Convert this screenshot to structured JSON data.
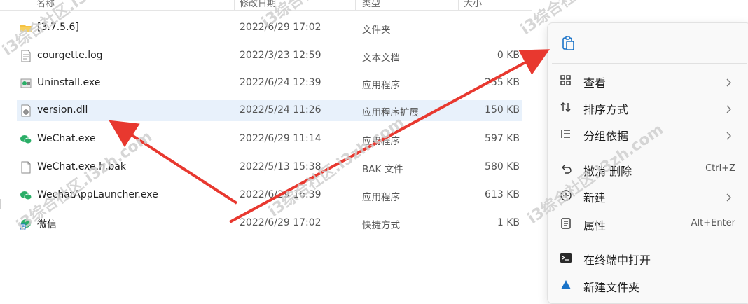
{
  "header": {
    "columns": [
      "名称",
      "修改日期",
      "类型",
      "大小"
    ]
  },
  "files": [
    {
      "name": "[3.7.5.6]",
      "date": "2022/6/29 17:02",
      "type": "文件夹",
      "size": "",
      "icon": "folder-icon"
    },
    {
      "name": "courgette.log",
      "date": "2022/3/23 12:59",
      "type": "文本文档",
      "size": "0 KB",
      "icon": "text-file-icon"
    },
    {
      "name": "Uninstall.exe",
      "date": "2022/6/24 12:39",
      "type": "应用程序",
      "size": "255 KB",
      "icon": "uninstall-exe-icon"
    },
    {
      "name": "version.dll",
      "date": "2022/5/24 11:26",
      "type": "应用程序扩展",
      "size": "150 KB",
      "icon": "dll-file-icon"
    },
    {
      "name": "WeChat.exe",
      "date": "2022/6/29 11:14",
      "type": "应用程序",
      "size": "597 KB",
      "icon": "wechat-icon"
    },
    {
      "name": "WeChat.exe.h.bak",
      "date": "2022/5/13 15:38",
      "type": "BAK 文件",
      "size": "580 KB",
      "icon": "blank-file-icon"
    },
    {
      "name": "WechatAppLauncher.exe",
      "date": "2022/6/29 16:39",
      "type": "应用程序",
      "size": "613 KB",
      "icon": "wechat-icon"
    },
    {
      "name": "微信",
      "date": "2022/6/29 17:02",
      "type": "快捷方式",
      "size": "1 KB",
      "icon": "shortcut-icon"
    }
  ],
  "context_menu": {
    "items": [
      {
        "label": "查看",
        "shortcut": "",
        "submenu": true,
        "icon": "view-icon"
      },
      {
        "label": "排序方式",
        "shortcut": "",
        "submenu": true,
        "icon": "sort-icon"
      },
      {
        "label": "分组依据",
        "shortcut": "",
        "submenu": true,
        "icon": "group-by-icon"
      },
      {
        "label": "撤消 删除",
        "shortcut": "Ctrl+Z",
        "submenu": false,
        "icon": "undo-icon"
      },
      {
        "label": "新建",
        "shortcut": "",
        "submenu": true,
        "icon": "new-icon"
      },
      {
        "label": "属性",
        "shortcut": "Alt+Enter",
        "submenu": false,
        "icon": "properties-icon"
      },
      {
        "label": "在终端中打开",
        "shortcut": "",
        "submenu": false,
        "icon": "terminal-icon"
      },
      {
        "label": "新建文件夹",
        "shortcut": "",
        "submenu": false,
        "icon": "new-folder-icon"
      }
    ]
  },
  "watermark": "i3综合社区.i3zh.com",
  "colors": {
    "selection": "#e8f1fb",
    "arrow": "#e8382f",
    "folder": "#f5c242",
    "wechat_green": "#2aae67",
    "accent_blue": "#1a73c8"
  }
}
